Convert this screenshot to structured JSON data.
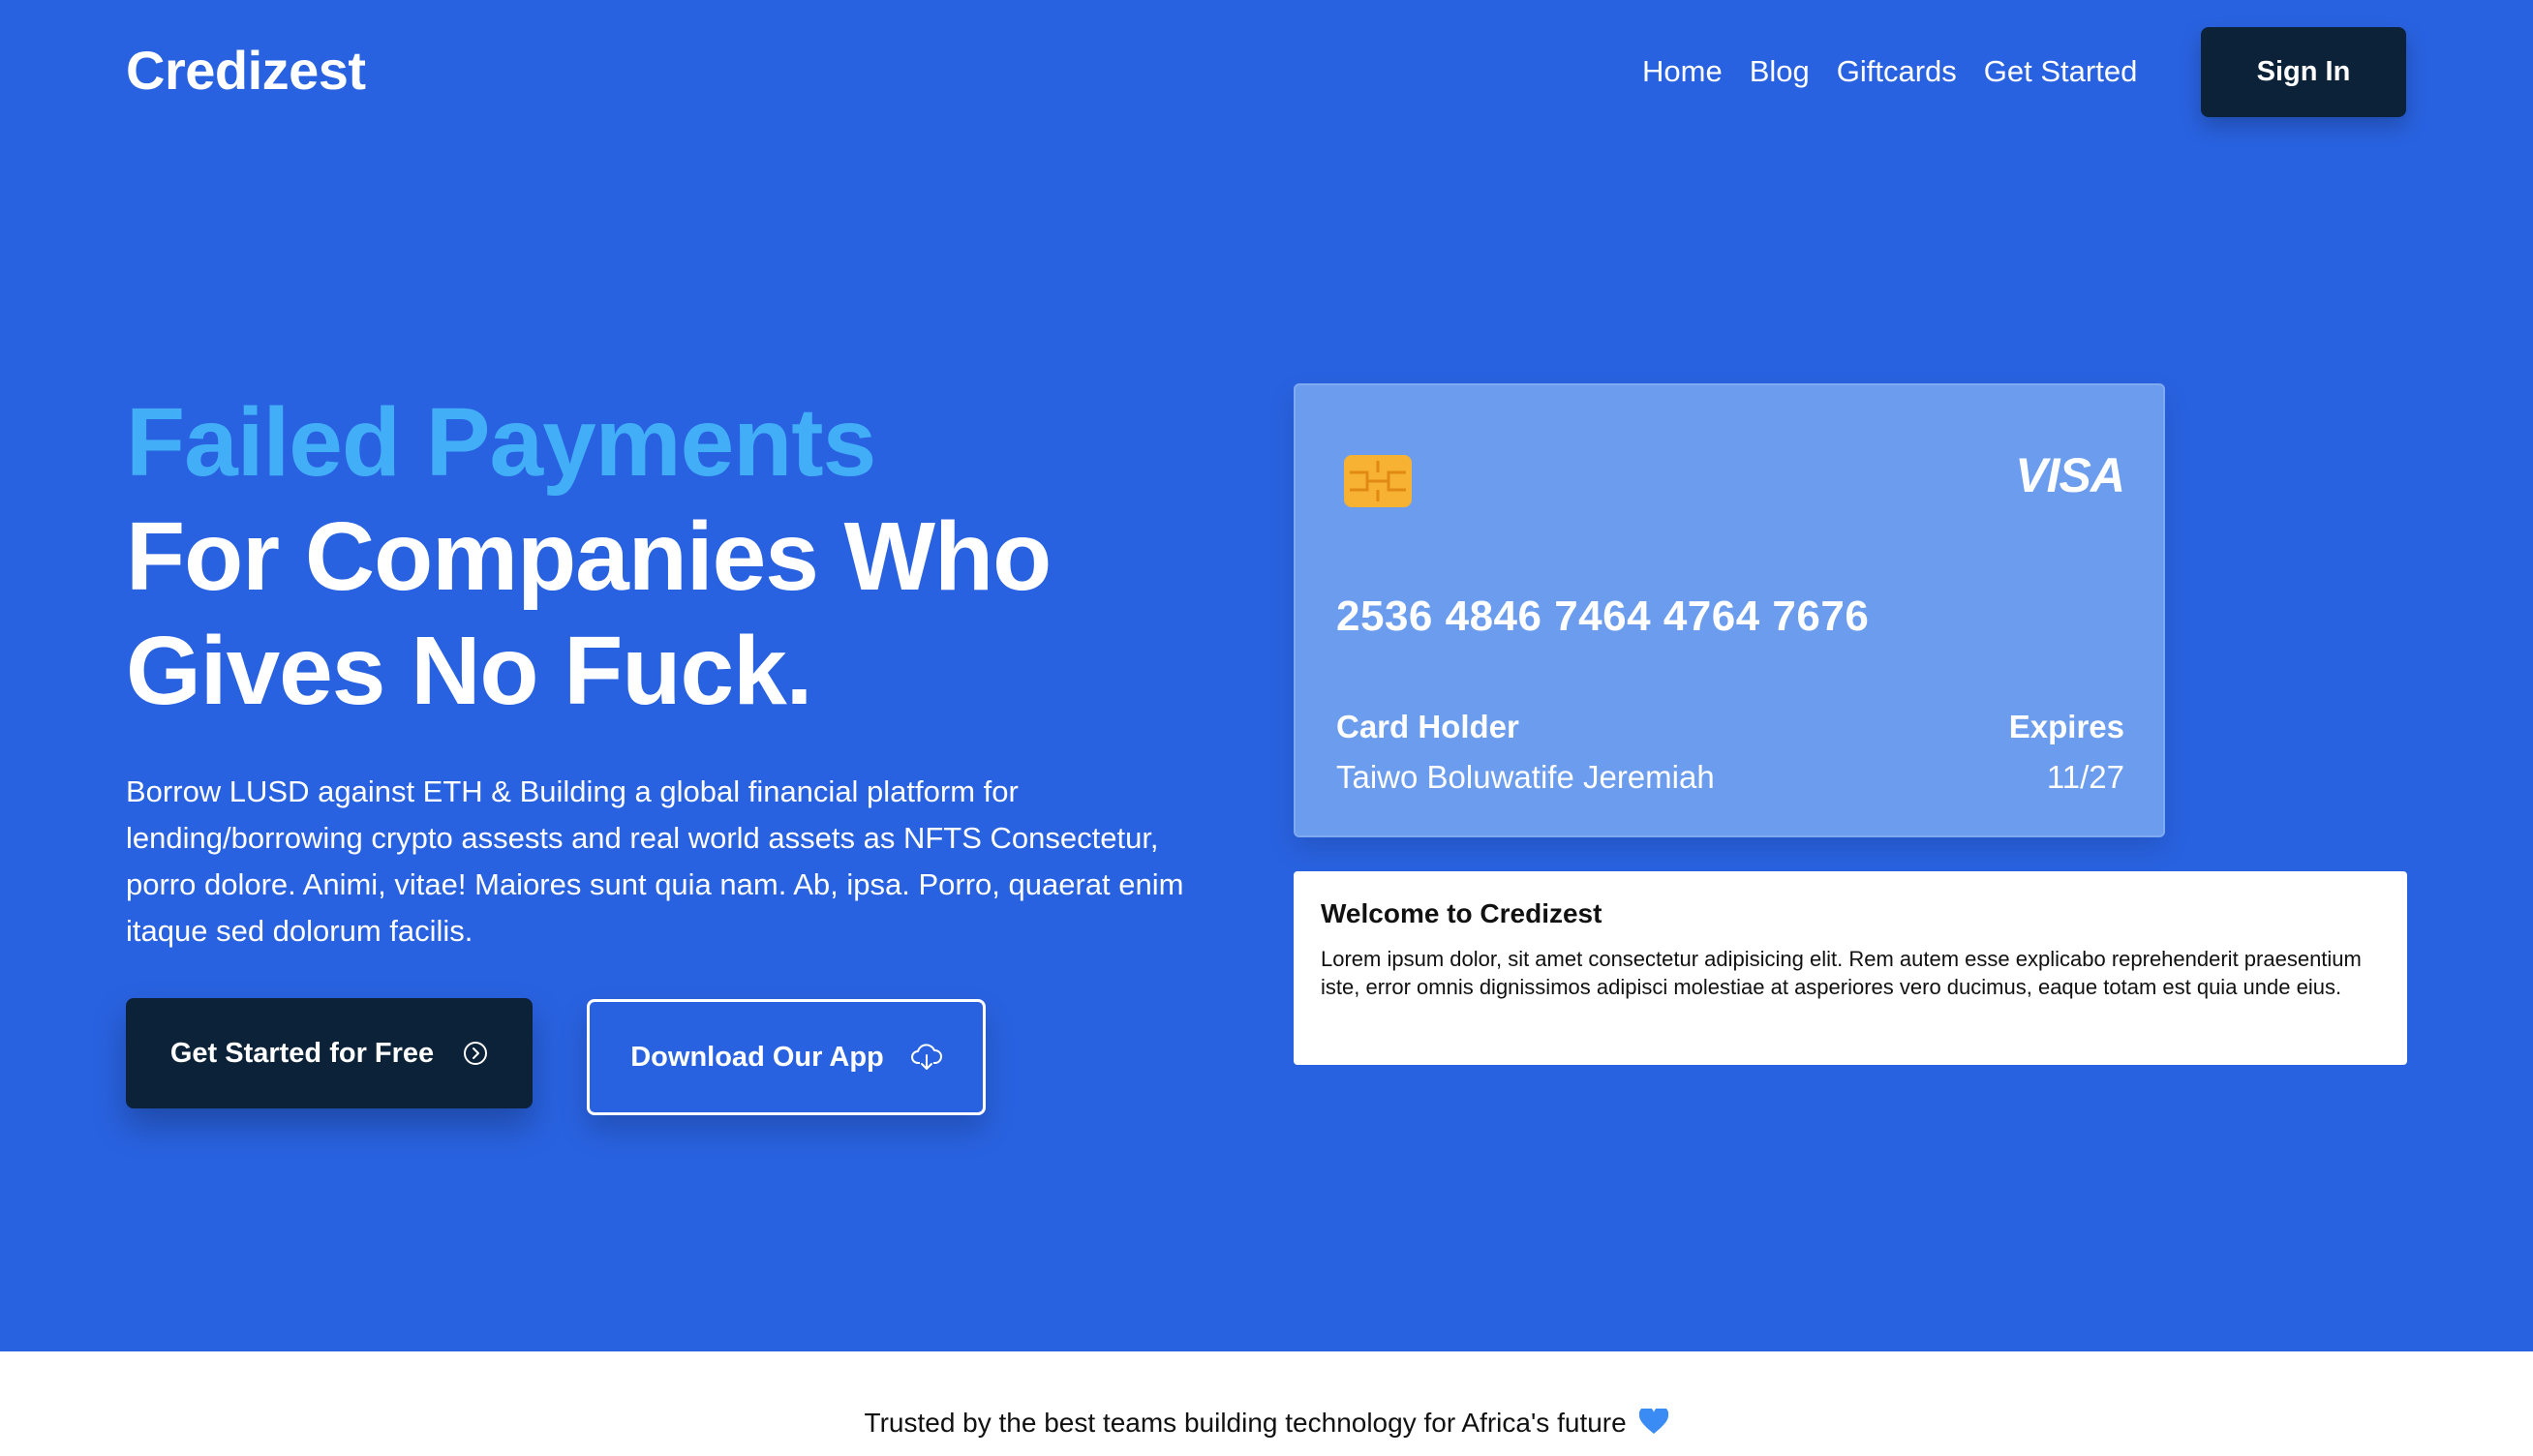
{
  "header": {
    "logo": "Credizest",
    "nav": [
      {
        "label": "Home"
      },
      {
        "label": "Blog"
      },
      {
        "label": "Giftcards"
      },
      {
        "label": "Get Started"
      }
    ],
    "sign_in_label": "Sign In"
  },
  "hero": {
    "headline_accent": "Failed Payments",
    "headline_line2": "For Companies Who",
    "headline_line3": "Gives No Fuck.",
    "description": "Borrow LUSD against ETH & Building a global financial platform for lending/borrowing crypto assests and real world assets as NFTS Consectetur, porro dolore. Animi, vitae! Maiores sunt quia nam. Ab, ipsa. Porro, quaerat enim itaque sed dolorum facilis.",
    "primary_button": "Get Started for Free",
    "secondary_button": "Download Our App",
    "icons": {
      "primary": "arrow-circle-right-icon",
      "secondary": "cloud-download-icon"
    }
  },
  "card": {
    "brand": "VISA",
    "number": "2536 4846 7464 4764 7676",
    "holder_label": "Card Holder",
    "holder_name": "Taiwo Boluwatife Jeremiah",
    "expires_label": "Expires",
    "expires_value": "11/27"
  },
  "welcome": {
    "title": "Welcome to Credizest",
    "text": "Lorem ipsum dolor, sit amet consectetur adipisicing elit. Rem autem esse explicabo reprehenderit praesentium iste, error omnis dignissimos adipisci molestiae at asperiores vero ducimus, eaque totam est quia unde eius."
  },
  "trusted": {
    "text": "Trusted by the best teams building technology for Africa's future"
  },
  "colors": {
    "hero_bg": "#2962e0",
    "accent": "#43aef8",
    "dark_button": "#0b2239",
    "card_bg": "#6b9cee"
  }
}
